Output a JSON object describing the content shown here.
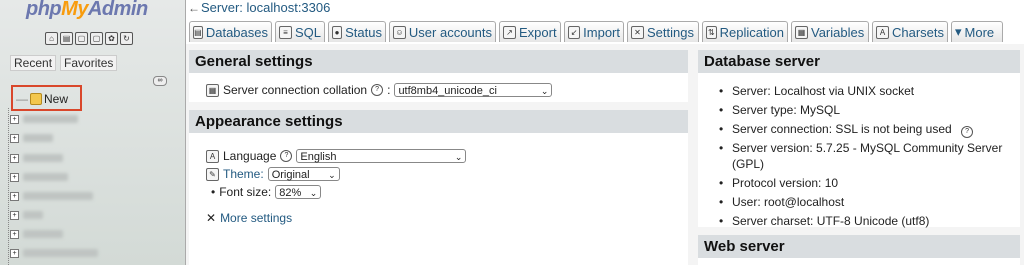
{
  "sidebar": {
    "logo_php": "php",
    "logo_my": "My",
    "logo_admin": "Admin",
    "tab_recent": "Recent",
    "tab_favorites": "Favorites",
    "new_label": "New"
  },
  "header": {
    "back_arrow": "←",
    "server_breadcrumb": "Server: localhost:3306"
  },
  "tabs": [
    {
      "label": "Databases"
    },
    {
      "label": "SQL"
    },
    {
      "label": "Status"
    },
    {
      "label": "User accounts"
    },
    {
      "label": "Export"
    },
    {
      "label": "Import"
    },
    {
      "label": "Settings"
    },
    {
      "label": "Replication"
    },
    {
      "label": "Variables"
    },
    {
      "label": "Charsets"
    },
    {
      "label": "More"
    }
  ],
  "general": {
    "title": "General settings",
    "collation_label": "Server connection collation",
    "collation_value": "utf8mb4_unicode_ci"
  },
  "appearance": {
    "title": "Appearance settings",
    "language_label": "Language",
    "language_value": "English",
    "theme_label": "Theme:",
    "theme_value": "Original",
    "fontsize_label": "Font size:",
    "fontsize_value": "82%",
    "more_settings": "More settings"
  },
  "dbserver": {
    "title": "Database server",
    "items": [
      "Server: Localhost via UNIX socket",
      "Server type: MySQL",
      "Server connection: SSL is not being used",
      "Server version: 5.7.25 - MySQL Community Server",
      "(GPL)",
      "Protocol version: 10",
      "User: root@localhost",
      "Server charset: UTF-8 Unicode (utf8)"
    ]
  },
  "webserver": {
    "title": "Web server"
  }
}
